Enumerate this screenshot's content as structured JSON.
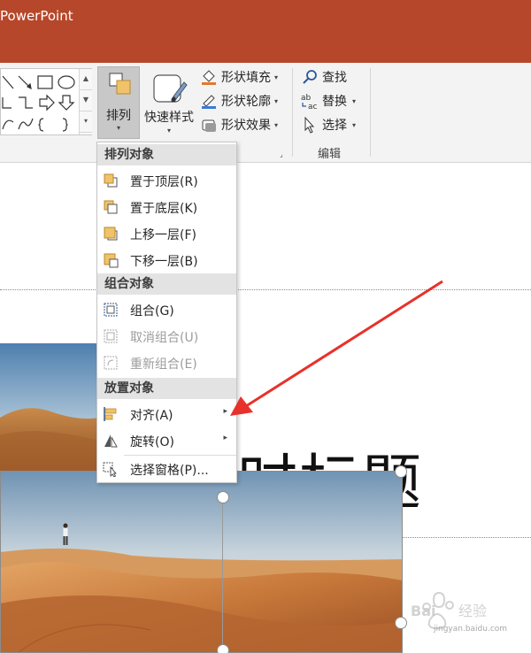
{
  "app": {
    "title": "PowerPoint",
    "accent_color": "#b7472a"
  },
  "ribbon": {
    "arrange_label": "排列",
    "quick_styles_label": "快速样式",
    "shape_fill_label": "形状填充",
    "shape_outline_label": "形状轮廓",
    "shape_effects_label": "形状效果",
    "find_label": "查找",
    "replace_label": "替换",
    "select_label": "选择",
    "editing_group_label": "编辑",
    "dropdown_caret": "▾",
    "launcher_icon": "dialog-launcher-icon"
  },
  "menu": {
    "sections": {
      "arrange_objects": "排列对象",
      "group_objects": "组合对象",
      "position_objects": "放置对象"
    },
    "items": {
      "bring_to_front": "置于顶层(R)",
      "send_to_back": "置于底层(K)",
      "bring_forward": "上移一层(F)",
      "send_backward": "下移一层(B)",
      "group": "组合(G)",
      "ungroup": "取消组合(U)",
      "regroup": "重新组合(E)",
      "align": "对齐(A)",
      "rotate": "旋转(O)",
      "selection_pane": "选择窗格(P)..."
    },
    "submenu_arrow": "▸"
  },
  "slide": {
    "title_text": "时标题"
  },
  "watermark": {
    "text": "jingyan.baidu.com"
  }
}
